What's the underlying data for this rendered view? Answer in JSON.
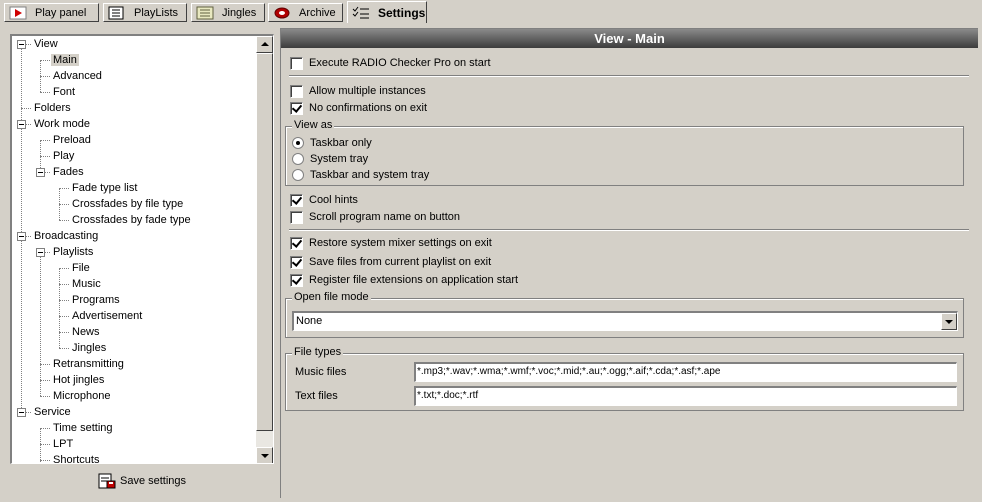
{
  "tabs": [
    {
      "label": "Play panel",
      "icon": "play-icon"
    },
    {
      "label": "PlayLists",
      "icon": "playlist-icon"
    },
    {
      "label": "Jingles",
      "icon": "jingles-icon"
    },
    {
      "label": "Archive",
      "icon": "archive-icon"
    },
    {
      "label": "Settings",
      "icon": "settings-icon",
      "active": true
    }
  ],
  "tree": {
    "items": [
      {
        "label": "View"
      },
      {
        "label": "Main",
        "selected": true
      },
      {
        "label": "Advanced"
      },
      {
        "label": "Font"
      },
      {
        "label": "Folders"
      },
      {
        "label": "Work mode"
      },
      {
        "label": "Preload"
      },
      {
        "label": "Play"
      },
      {
        "label": "Fades"
      },
      {
        "label": "Fade type list"
      },
      {
        "label": "Crossfades by file type"
      },
      {
        "label": "Crossfades by fade type"
      },
      {
        "label": "Broadcasting"
      },
      {
        "label": "Playlists"
      },
      {
        "label": "File"
      },
      {
        "label": "Music"
      },
      {
        "label": "Programs"
      },
      {
        "label": "Advertisement"
      },
      {
        "label": "News"
      },
      {
        "label": "Jingles"
      },
      {
        "label": "Retransmitting"
      },
      {
        "label": "Hot jingles"
      },
      {
        "label": "Microphone"
      },
      {
        "label": "Service"
      },
      {
        "label": "Time setting"
      },
      {
        "label": "LPT"
      },
      {
        "label": "Shortcuts"
      }
    ]
  },
  "save_button": {
    "label": "Save settings",
    "icon": "save-settings-icon"
  },
  "panel": {
    "title": "View - Main",
    "execute_on_start": {
      "label": "Execute RADIO Checker Pro on start",
      "checked": false
    },
    "allow_multiple": {
      "label": "Allow multiple instances",
      "checked": false
    },
    "no_confirmations": {
      "label": "No confirmations on exit",
      "checked": true
    },
    "view_as": {
      "title": "View as",
      "options": [
        {
          "label": "Taskbar only",
          "selected": true
        },
        {
          "label": "System tray",
          "selected": false
        },
        {
          "label": "Taskbar and system tray",
          "selected": false
        }
      ]
    },
    "cool_hints": {
      "label": "Cool hints",
      "checked": true
    },
    "scroll_name": {
      "label": "Scroll program name on button",
      "checked": false
    },
    "restore_mixer": {
      "label": "Restore system mixer settings on exit",
      "checked": true
    },
    "save_files": {
      "label": "Save files from current playlist on exit",
      "checked": true
    },
    "register_ext": {
      "label": "Register file extensions on application start",
      "checked": true
    },
    "open_file_mode": {
      "title": "Open file mode",
      "value": "None"
    },
    "file_types": {
      "title": "File types",
      "music_label": "Music files",
      "music_value": "*.mp3;*.wav;*.wma;*.wmf;*.voc;*.mid;*.au;*.ogg;*.aif;*.cda;*.asf;*.ape",
      "text_label": "Text files",
      "text_value": "*.txt;*.doc;*.rtf"
    }
  }
}
